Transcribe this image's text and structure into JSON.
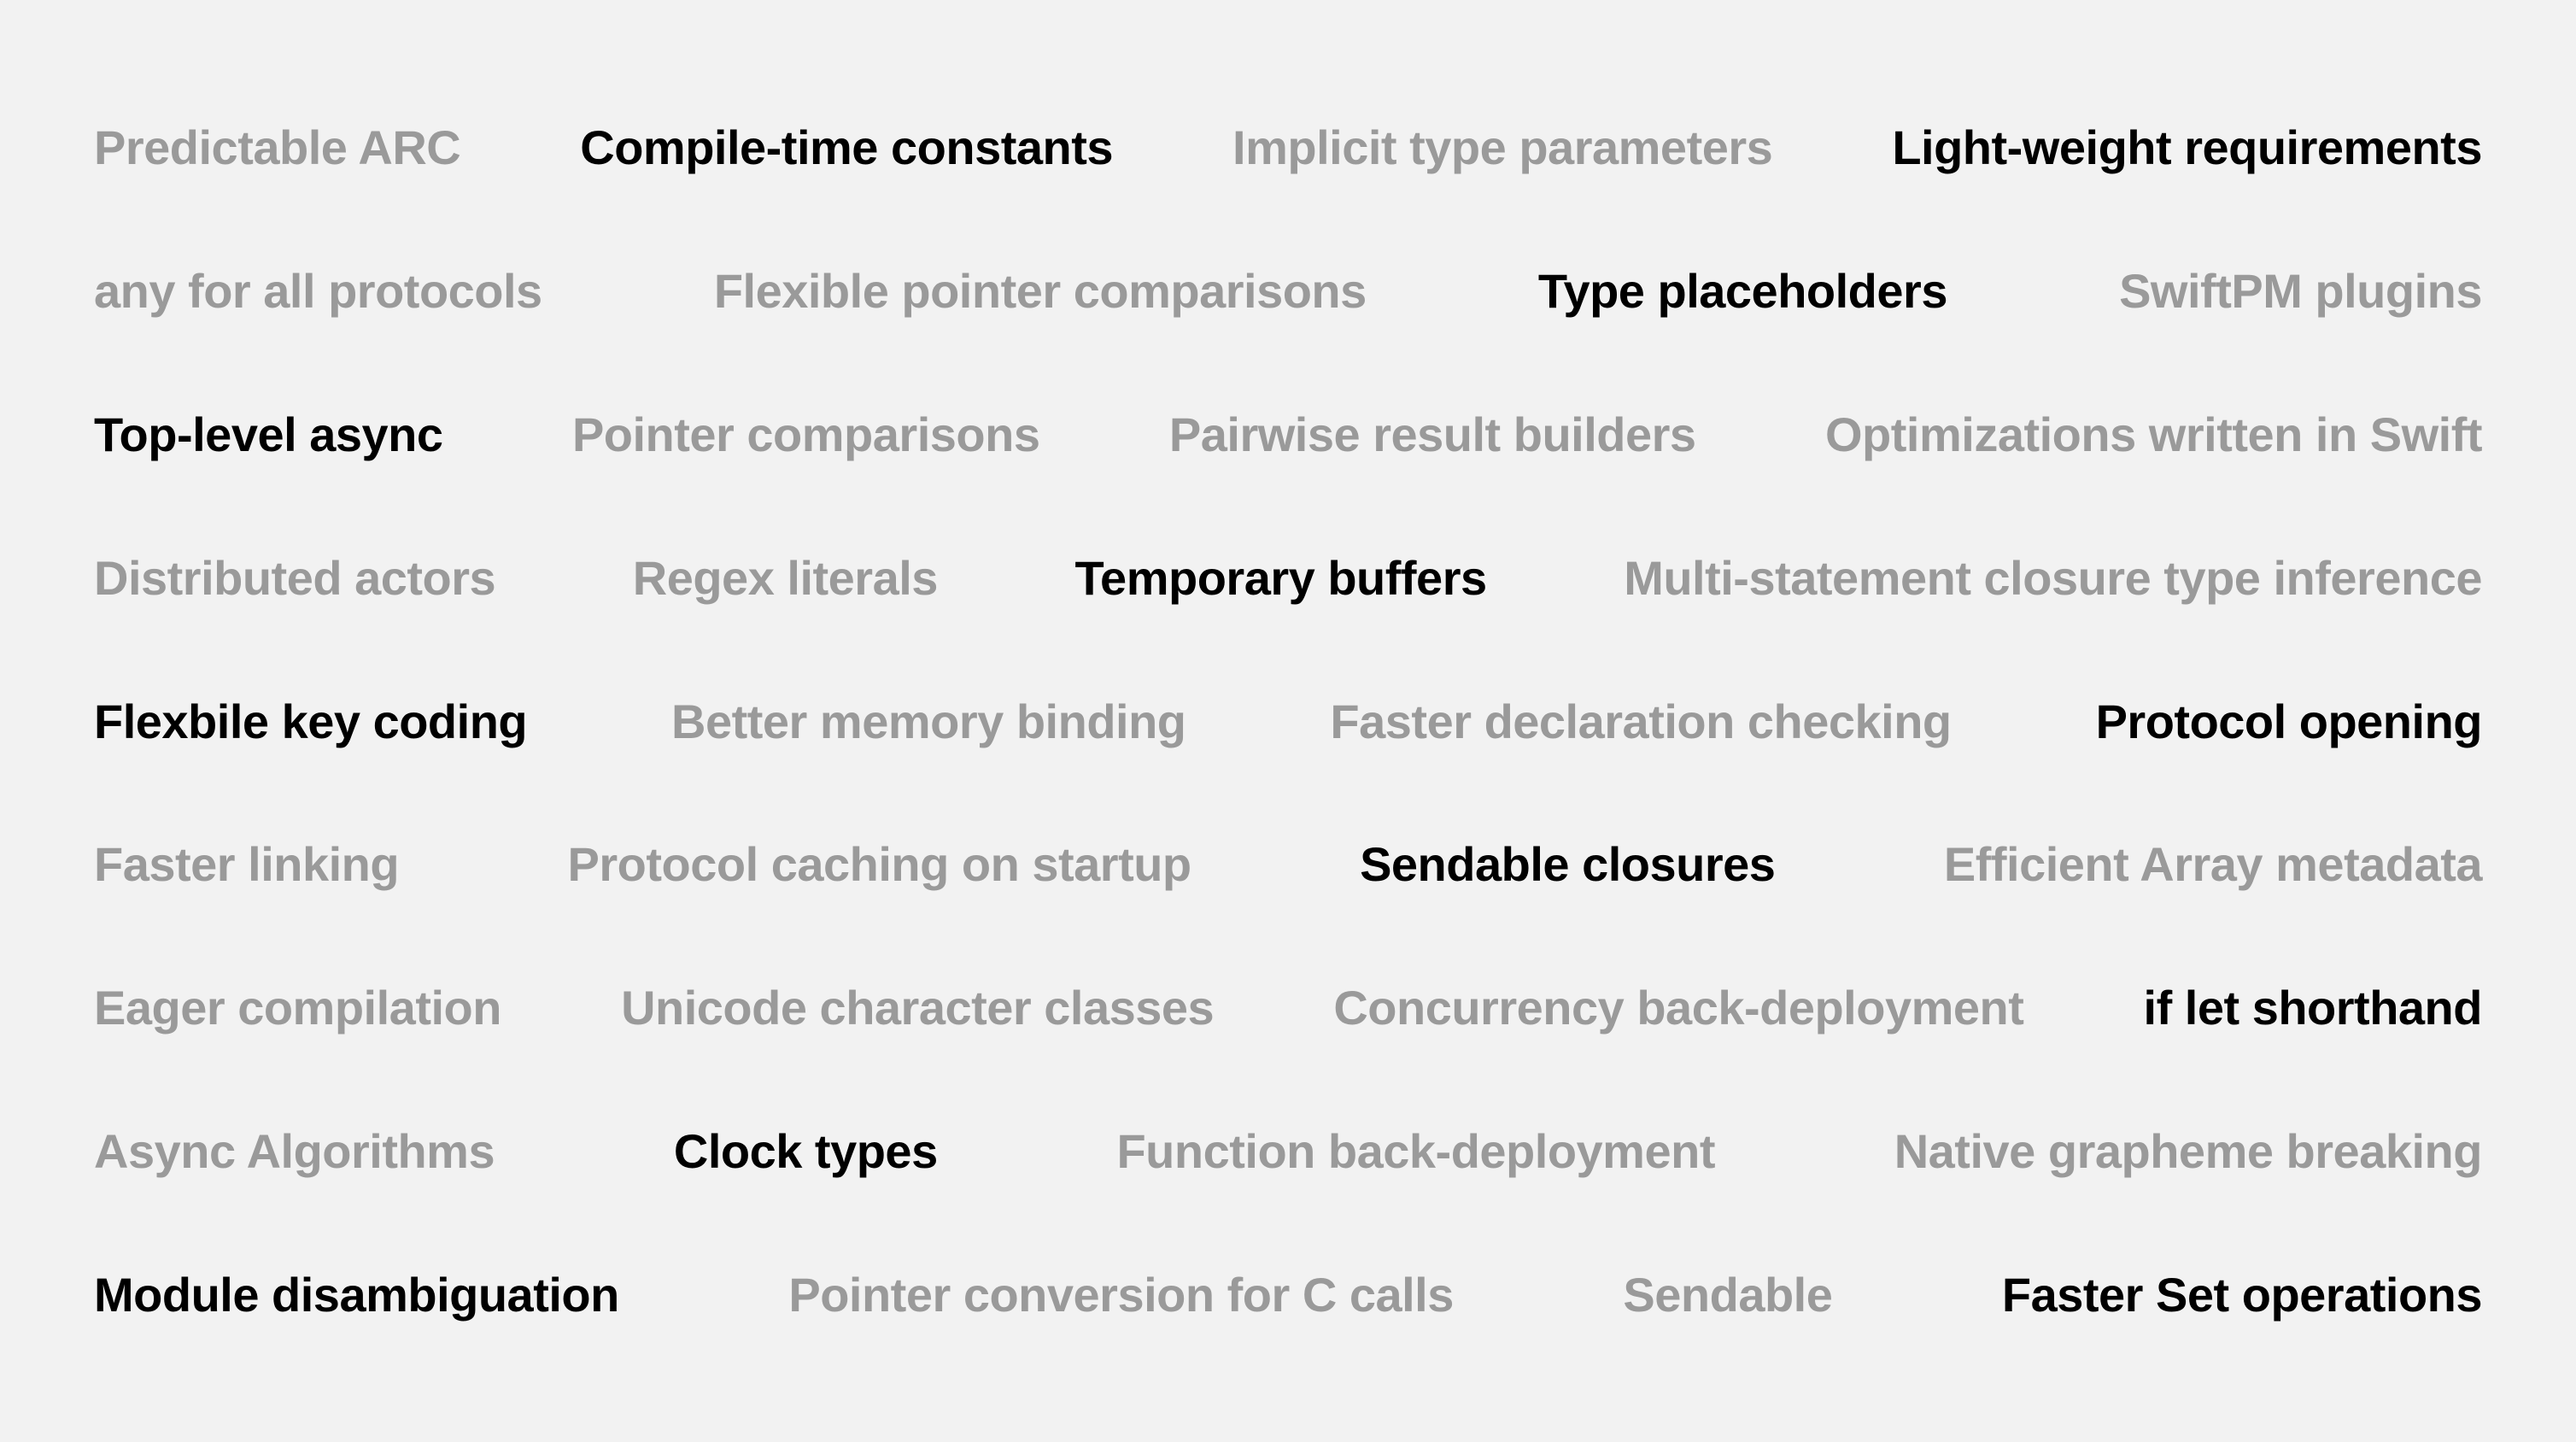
{
  "rows": [
    [
      {
        "text": "Predictable ARC",
        "emphasis": "muted"
      },
      {
        "text": "Compile-time constants",
        "emphasis": "bold"
      },
      {
        "text": "Implicit type parameters",
        "emphasis": "muted"
      },
      {
        "text": "Light-weight requirements",
        "emphasis": "bold"
      }
    ],
    [
      {
        "text": "any for all protocols",
        "emphasis": "muted"
      },
      {
        "text": "Flexible pointer comparisons",
        "emphasis": "muted"
      },
      {
        "text": "Type placeholders",
        "emphasis": "bold"
      },
      {
        "text": "SwiftPM plugins",
        "emphasis": "muted"
      }
    ],
    [
      {
        "text": "Top-level async",
        "emphasis": "bold"
      },
      {
        "text": "Pointer comparisons",
        "emphasis": "muted"
      },
      {
        "text": "Pairwise result builders",
        "emphasis": "muted"
      },
      {
        "text": "Optimizations written in Swift",
        "emphasis": "muted"
      }
    ],
    [
      {
        "text": "Distributed actors",
        "emphasis": "muted"
      },
      {
        "text": "Regex literals",
        "emphasis": "muted"
      },
      {
        "text": "Temporary buffers",
        "emphasis": "bold"
      },
      {
        "text": "Multi-statement closure type inference",
        "emphasis": "muted"
      }
    ],
    [
      {
        "text": "Flexbile key coding",
        "emphasis": "bold"
      },
      {
        "text": "Better memory binding",
        "emphasis": "muted"
      },
      {
        "text": "Faster declaration checking",
        "emphasis": "muted"
      },
      {
        "text": "Protocol opening",
        "emphasis": "bold"
      }
    ],
    [
      {
        "text": "Faster linking",
        "emphasis": "muted"
      },
      {
        "text": "Protocol caching on startup",
        "emphasis": "muted"
      },
      {
        "text": "Sendable closures",
        "emphasis": "bold"
      },
      {
        "text": "Efficient Array metadata",
        "emphasis": "muted"
      }
    ],
    [
      {
        "text": "Eager compilation",
        "emphasis": "muted"
      },
      {
        "text": "Unicode character classes",
        "emphasis": "muted"
      },
      {
        "text": "Concurrency back-deployment",
        "emphasis": "muted"
      },
      {
        "text": "if let shorthand",
        "emphasis": "bold"
      }
    ],
    [
      {
        "text": "Async Algorithms",
        "emphasis": "muted"
      },
      {
        "text": "Clock types",
        "emphasis": "bold"
      },
      {
        "text": "Function back-deployment",
        "emphasis": "muted"
      },
      {
        "text": "Native grapheme breaking",
        "emphasis": "muted"
      }
    ],
    [
      {
        "text": "Module disambiguation",
        "emphasis": "bold"
      },
      {
        "text": "Pointer conversion for C calls",
        "emphasis": "muted"
      },
      {
        "text": "Sendable",
        "emphasis": "muted"
      },
      {
        "text": "Faster Set operations",
        "emphasis": "bold"
      }
    ]
  ]
}
